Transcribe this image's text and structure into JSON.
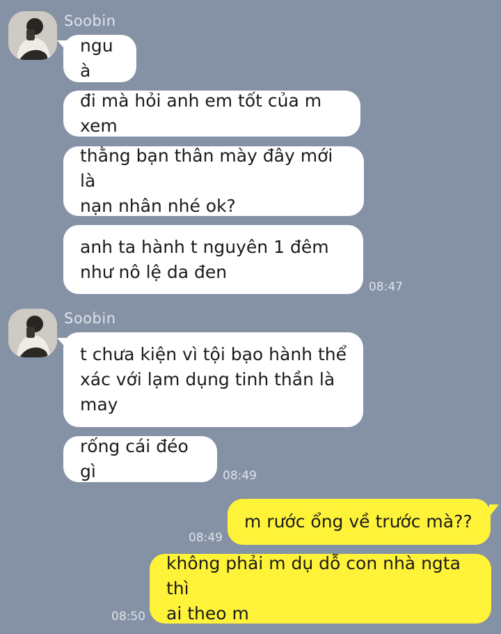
{
  "groups": [
    {
      "sender": "Soobin",
      "avatar_icon": "user-avatar-photo"
    },
    {
      "sender": "Soobin",
      "avatar_icon": "user-avatar-photo"
    }
  ],
  "messages": [
    {
      "text": "ngu à",
      "direction": "incoming"
    },
    {
      "text": "đi mà hỏi anh em tốt của m xem",
      "direction": "incoming"
    },
    {
      "text": "thằng bạn thân mày đây mới là\nnạn nhân nhé ok?",
      "direction": "incoming"
    },
    {
      "text": "anh ta hành t nguyên 1 đêm\nnhư nô lệ da đen",
      "direction": "incoming",
      "time": "08:47"
    },
    {
      "text": "t chưa kiện vì tội bạo hành thể\nxác với lạm dụng tinh thần là\nmay",
      "direction": "incoming"
    },
    {
      "text": "rống cái đéo gì",
      "direction": "incoming",
      "time": "08:49"
    },
    {
      "text": "m rước ổng về trước mà??",
      "direction": "outgoing",
      "time": "08:49"
    },
    {
      "text": "không phải m dụ dỗ con nhà ngta thì\nai theo m",
      "direction": "outgoing",
      "time": "08:50"
    }
  ],
  "colors": {
    "background": "#8591a5",
    "incoming_bubble": "#ffffff",
    "outgoing_bubble": "#fff33a"
  }
}
